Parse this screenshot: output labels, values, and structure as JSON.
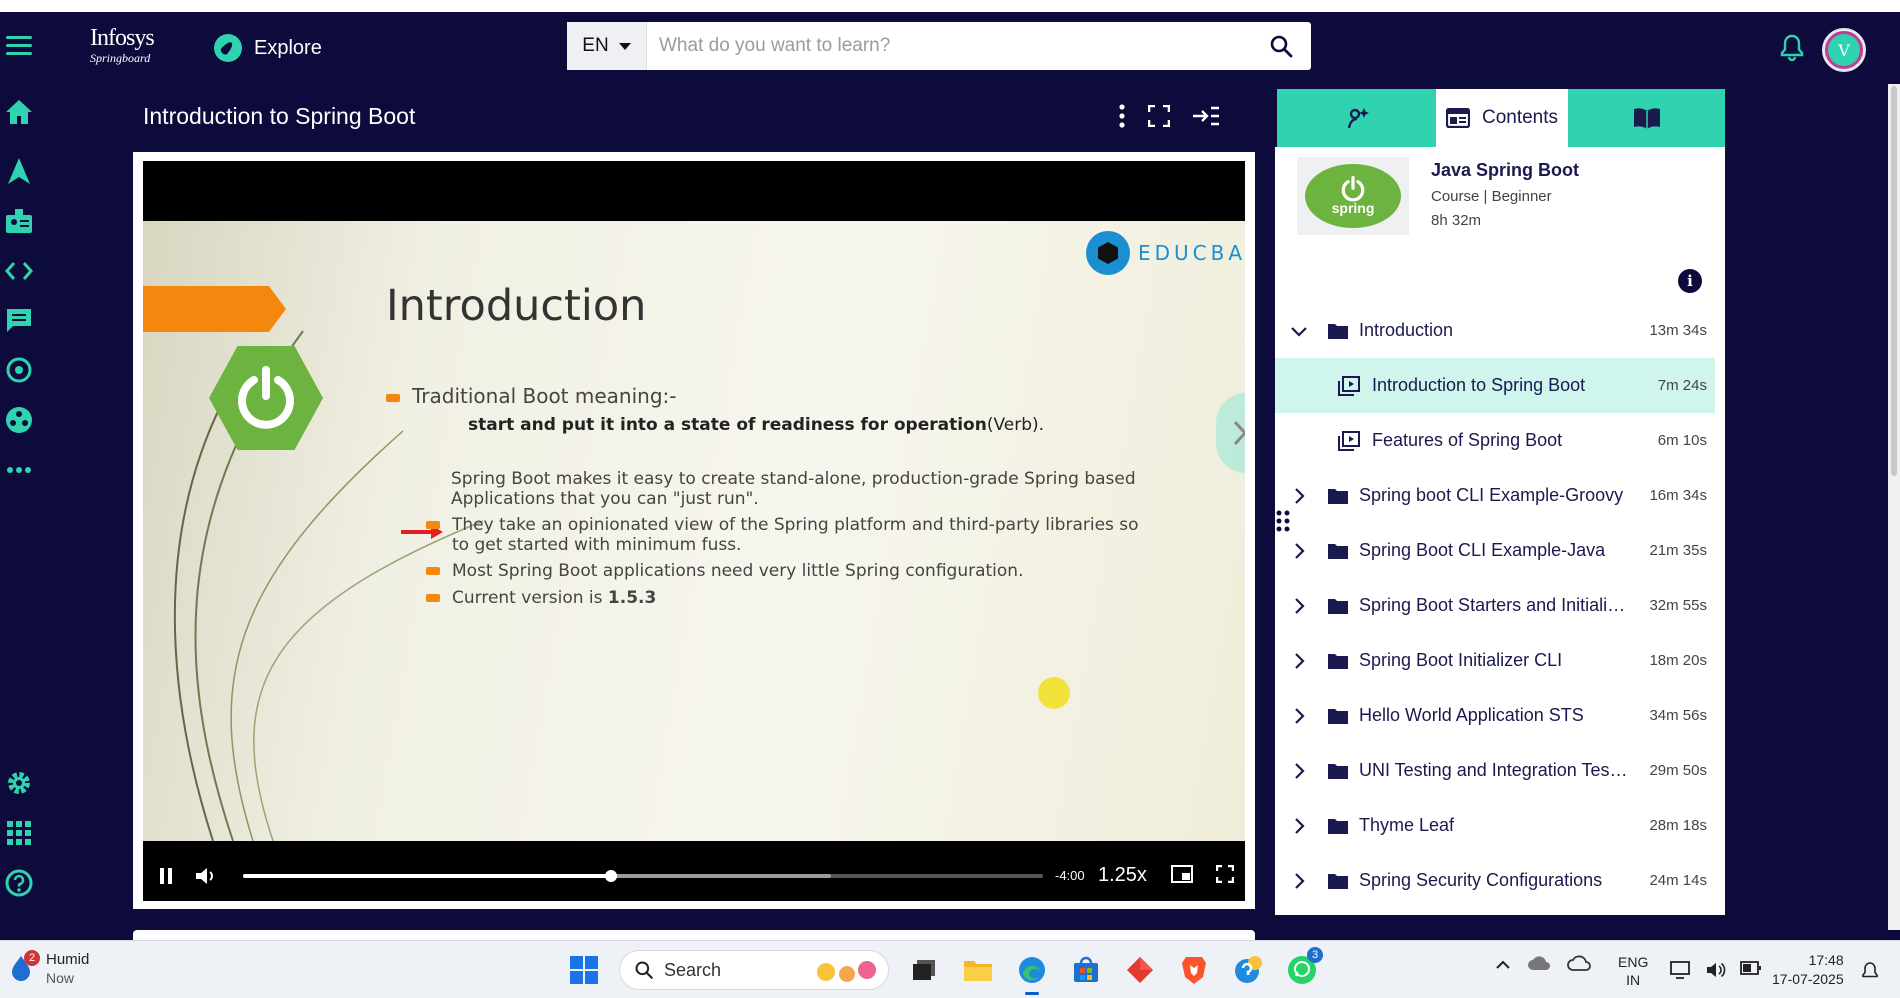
{
  "header": {
    "logo_line1": "Infosys",
    "logo_line2": "Springboard",
    "explore_label": "Explore",
    "language": "EN",
    "search_placeholder": "What do you want to learn?",
    "avatar_letter": "V"
  },
  "title_bar": {
    "title": "Introduction to Spring Boot"
  },
  "slide": {
    "heading": "Introduction",
    "brand": "EDUCBA",
    "logo_text": "spring",
    "line1": "Traditional Boot meaning:-",
    "line2_bold": "start and put it into a state of readiness for operation",
    "line2_rest": "(Verb).",
    "line3a": "Spring Boot makes it easy to create stand-alone, production-grade Spring based",
    "line3b": "Applications that you can \"just run\".",
    "line4a": "They take an opinionated view of the Spring platform and third-party libraries so",
    "line4b": "to get started with minimum fuss.",
    "line5": "Most Spring Boot applications need very little Spring configuration.",
    "line6a": "Current version is ",
    "line6b": "1.5.3"
  },
  "player": {
    "time_left": "-4:00",
    "speed": "1.25x",
    "played_fraction": 0.46,
    "buffered_fraction": 0.735
  },
  "right_panel": {
    "tabs": [
      "Contents"
    ],
    "course": {
      "title": "Java Spring Boot",
      "subtitle": "Course | Beginner",
      "duration": "8h 32m"
    },
    "sections": [
      {
        "label": "Introduction",
        "duration": "13m 34s",
        "expanded": true
      },
      {
        "label": "Introduction to Spring Boot",
        "duration": "7m 24s",
        "sub": true,
        "selected": true
      },
      {
        "label": "Features of Spring Boot",
        "duration": "6m 10s",
        "sub": true
      },
      {
        "label": "Spring boot CLI Example-Groovy",
        "duration": "16m 34s"
      },
      {
        "label": "Spring Boot CLI Example-Java",
        "duration": "21m 35s"
      },
      {
        "label": "Spring Boot Starters and Initializ...",
        "duration": "32m 55s"
      },
      {
        "label": "Spring Boot Initializer CLI",
        "duration": "18m 20s"
      },
      {
        "label": "Hello World Application STS",
        "duration": "34m 56s"
      },
      {
        "label": "UNI Testing and Integration Testi...",
        "duration": "29m 50s"
      },
      {
        "label": "Thyme Leaf",
        "duration": "28m 18s"
      },
      {
        "label": "Spring Security Configurations",
        "duration": "24m 14s"
      }
    ]
  },
  "taskbar": {
    "weather_badge": "2",
    "weather_title": "Humid",
    "weather_sub": "Now",
    "search_label": "Search",
    "whatsapp_badge": "3",
    "lang_line1": "ENG",
    "lang_line2": "IN",
    "time": "17:48",
    "date": "17-07-2025"
  },
  "colors": {
    "bg": "#0c0b3b",
    "accent": "#2fd3b0",
    "spring_green": "#6db33f",
    "slide_orange": "#f5870e"
  }
}
